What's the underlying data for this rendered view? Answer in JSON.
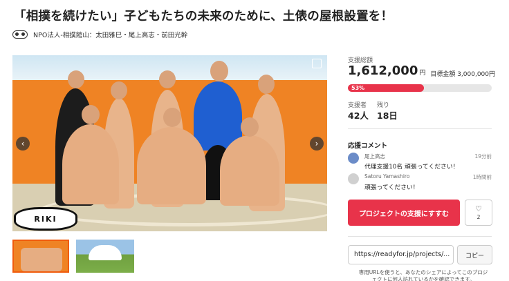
{
  "page": {
    "title": "「相撲を続けたい」子どもたちの未来のために、土俵の屋根設置を！",
    "org_name": "NPO法人-相撲館山：",
    "owners": "太田雅巳・尾上高志・前田光幹"
  },
  "gallery": {
    "logo_text": "RIKI",
    "prev_label": "‹",
    "next_label": "›"
  },
  "funding": {
    "raised_label": "支援総額",
    "raised_amount": "1,612,000",
    "raised_unit": "円",
    "goal_text": "目標金額 3,000,000円",
    "progress_percent": 53,
    "progress_label": "53%",
    "supporters_label": "支援者",
    "supporters_value": "42人",
    "remaining_label": "残り",
    "remaining_value": "18日"
  },
  "comments": {
    "section_title": "応援コメント",
    "items": [
      {
        "name": "尾上高志",
        "time": "19分前",
        "text": "代理支援10名 頑張ってください！"
      },
      {
        "name": "Satoru Yamashiro",
        "time": "1時間前",
        "text": "頑張ってください！"
      }
    ]
  },
  "actions": {
    "support_label": "プロジェクトの支援にすすむ",
    "favorite_icon": "heart-icon",
    "favorite_count": "2",
    "share_url": "https://readyfor.jp/projects/...",
    "copy_label": "コピー",
    "share_note": "専用URLを使うと、あなたのシェアによってこのプロジェクトに何人訪れているかを確認できます。"
  },
  "colors": {
    "accent": "#e8334a",
    "wall": "#ef8324"
  }
}
